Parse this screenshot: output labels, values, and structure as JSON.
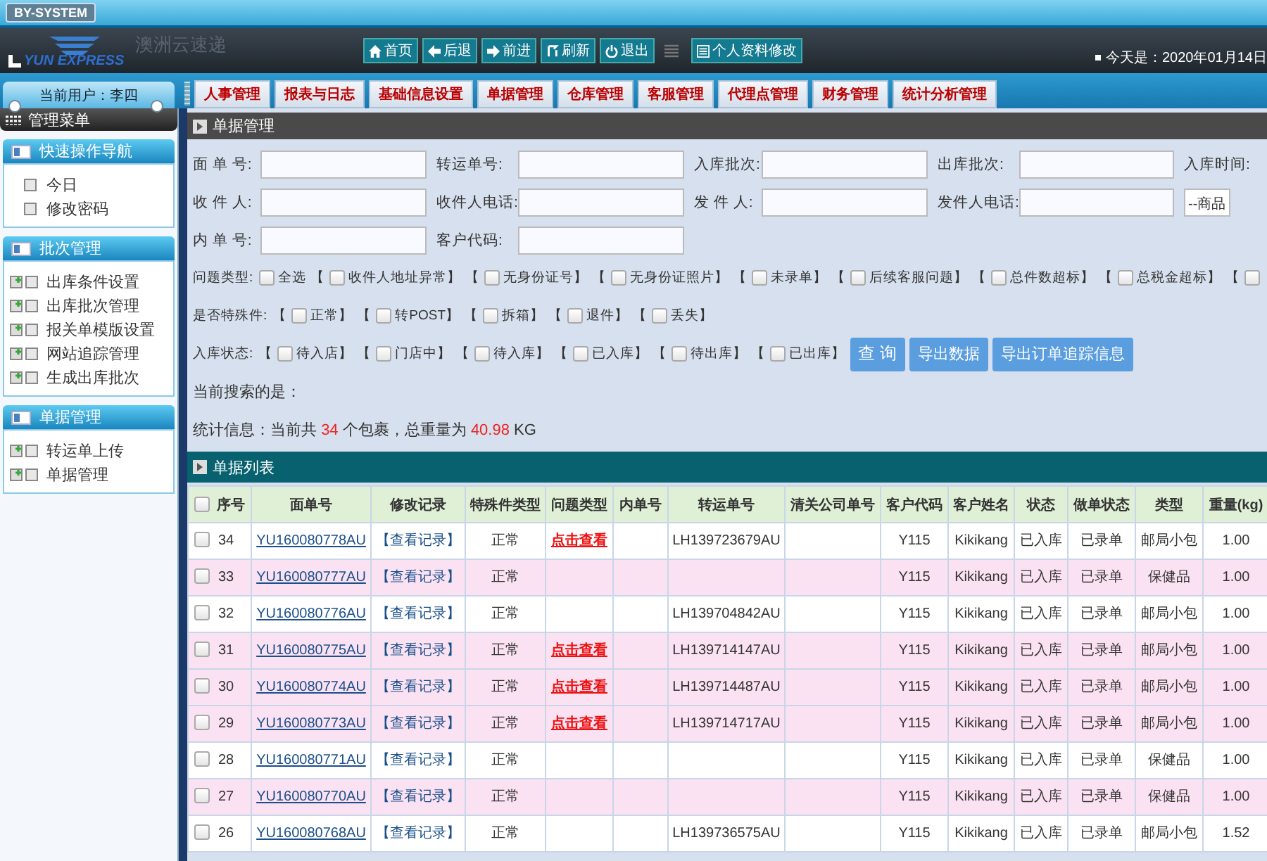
{
  "system_badge": "BY-SYSTEM",
  "logo": {
    "brand": "YUN EXPRESS",
    "name": "澳洲云速递"
  },
  "nav_buttons": [
    "首页",
    "后退",
    "前进",
    "刷新",
    "退出"
  ],
  "profile_button": "个人资料修改",
  "date": "今天是：2020年01月14日",
  "current_user": "当前用户：李四",
  "menu_tabs": [
    {
      "label": "人事管理",
      "selected": false
    },
    {
      "label": "报表与日志",
      "selected": false
    },
    {
      "label": "基础信息设置",
      "selected": false
    },
    {
      "label": "单据管理",
      "selected": false
    },
    {
      "label": "仓库管理",
      "selected": false
    },
    {
      "label": "客服管理",
      "selected": false
    },
    {
      "label": "代理点管理",
      "selected": false
    },
    {
      "label": "财务管理",
      "selected": false
    },
    {
      "label": "统计分析管理",
      "selected": false
    }
  ],
  "sidebar": {
    "title": "管理菜单",
    "sections": [
      {
        "title": "快速操作导航",
        "items": [
          {
            "label": "今日",
            "kind": "page"
          },
          {
            "label": "修改密码",
            "kind": "page"
          }
        ]
      },
      {
        "title": "批次管理",
        "items": [
          {
            "label": "出库条件设置",
            "kind": "add-page"
          },
          {
            "label": "出库批次管理",
            "kind": "add-page"
          },
          {
            "label": "报关单模版设置",
            "kind": "add-page"
          },
          {
            "label": "网站追踪管理",
            "kind": "add-page"
          },
          {
            "label": "生成出库批次",
            "kind": "add-page"
          }
        ]
      },
      {
        "title": "单据管理",
        "items": [
          {
            "label": "转运单上传",
            "kind": "add-page"
          },
          {
            "label": "单据管理",
            "kind": "add-page"
          }
        ]
      }
    ]
  },
  "search_panel": {
    "title": "单据管理",
    "form_rows": [
      [
        {
          "label": "面 单 号:",
          "kind": "input"
        },
        {
          "label": "转运单号:",
          "kind": "input"
        },
        {
          "label": "入库批次:",
          "kind": "input"
        },
        {
          "label": "出库批次:",
          "kind": "input"
        },
        {
          "label": "入库时间:",
          "kind": "label"
        }
      ],
      [
        {
          "label": "收 件 人:",
          "kind": "input"
        },
        {
          "label": "收件人电话:",
          "kind": "input"
        },
        {
          "label": "发 件 人:",
          "kind": "input"
        },
        {
          "label": "发件人电话:",
          "kind": "input"
        },
        {
          "value": "--商品",
          "kind": "select"
        }
      ],
      [
        {
          "label": "内 单 号:",
          "kind": "input"
        },
        {
          "label": "客户代码:",
          "kind": "input"
        }
      ]
    ],
    "filters": [
      {
        "label": "问题类型:",
        "options": [
          {
            "label": "全选",
            "checked": false
          },
          {
            "prefix": "【",
            "label": "收件人地址异常】",
            "checked": false
          },
          {
            "prefix": "【",
            "label": "无身份证号】",
            "checked": false
          },
          {
            "prefix": "【",
            "label": "无身份证照片】",
            "checked": false
          },
          {
            "prefix": "【",
            "label": "未录单】",
            "checked": false
          },
          {
            "prefix": "【",
            "label": "后续客服问题】",
            "checked": false
          },
          {
            "prefix": "【",
            "label": "总件数超标】",
            "checked": false
          },
          {
            "prefix": "【",
            "label": "总税金超标】",
            "checked": false
          },
          {
            "prefix": "【",
            "checked": false
          }
        ]
      },
      {
        "label": "是否特殊件:",
        "options": [
          {
            "prefix": "【",
            "label": "正常】",
            "checked": false
          },
          {
            "prefix": "【",
            "label": "转POST】",
            "checked": false
          },
          {
            "prefix": "【",
            "label": "拆箱】",
            "checked": false
          },
          {
            "prefix": "【",
            "label": "退件】",
            "checked": false
          },
          {
            "prefix": "【",
            "label": "丢失】",
            "checked": false
          }
        ]
      },
      {
        "label": "入库状态:",
        "options": [
          {
            "prefix": "【",
            "label": "待入店】",
            "checked": false
          },
          {
            "prefix": "【",
            "label": "门店中】",
            "checked": false
          },
          {
            "prefix": "【",
            "label": "待入库】",
            "checked": false
          },
          {
            "prefix": "【",
            "label": "已入库】",
            "checked": false
          },
          {
            "prefix": "【",
            "label": "待出库】",
            "checked": false
          },
          {
            "prefix": "【",
            "label": "已出库】",
            "checked": false
          }
        ],
        "buttons": [
          "查 询",
          "导出数据",
          "导出订单追踪信息"
        ]
      }
    ],
    "current_search": "当前搜索的是：",
    "stats": "统计信息：当前共 **34** 个包裹，总重量为 **40.98** KG"
  },
  "list": {
    "title": "单据列表",
    "header_checked": false,
    "columns": [
      "序号",
      "面单号",
      "修改记录",
      "特殊件类型",
      "问题类型",
      "内单号",
      "转运单号",
      "清关公司单号",
      "客户代码",
      "客户姓名",
      "状态",
      "做单状态",
      "类型",
      "重量(kg)"
    ],
    "rows": [
      {
        "no": "34",
        "waybill": "YU160080778AU",
        "record": "【查看记录】",
        "special": "正常",
        "problem": "点击查看",
        "transfer": "LH139723679AU",
        "code": "Y115",
        "name": "Kikikang",
        "status": "已入库",
        "make_status": "已录单",
        "type": "邮局小包",
        "weight": "1.00",
        "checked": false,
        "highlighted": false
      },
      {
        "no": "33",
        "waybill": "YU160080777AU",
        "record": "【查看记录】",
        "special": "正常",
        "code": "Y115",
        "name": "Kikikang",
        "status": "已入库",
        "make_status": "已录单",
        "type": "保健品",
        "weight": "1.00",
        "checked": false,
        "highlighted": true
      },
      {
        "no": "32",
        "waybill": "YU160080776AU",
        "record": "【查看记录】",
        "special": "正常",
        "transfer": "LH139704842AU",
        "code": "Y115",
        "name": "Kikikang",
        "status": "已入库",
        "make_status": "已录单",
        "type": "邮局小包",
        "weight": "1.00",
        "checked": false,
        "highlighted": false
      },
      {
        "no": "31",
        "waybill": "YU160080775AU",
        "record": "【查看记录】",
        "special": "正常",
        "problem": "点击查看",
        "transfer": "LH139714147AU",
        "code": "Y115",
        "name": "Kikikang",
        "status": "已入库",
        "make_status": "已录单",
        "type": "邮局小包",
        "weight": "1.00",
        "checked": false,
        "highlighted": true
      },
      {
        "no": "30",
        "waybill": "YU160080774AU",
        "record": "【查看记录】",
        "special": "正常",
        "problem": "点击查看",
        "transfer": "LH139714487AU",
        "code": "Y115",
        "name": "Kikikang",
        "status": "已入库",
        "make_status": "已录单",
        "type": "邮局小包",
        "weight": "1.00",
        "checked": false,
        "highlighted": true
      },
      {
        "no": "29",
        "waybill": "YU160080773AU",
        "record": "【查看记录】",
        "special": "正常",
        "problem": "点击查看",
        "transfer": "LH139714717AU",
        "code": "Y115",
        "name": "Kikikang",
        "status": "已入库",
        "make_status": "已录单",
        "type": "邮局小包",
        "weight": "1.00",
        "checked": false,
        "highlighted": true
      },
      {
        "no": "28",
        "waybill": "YU160080771AU",
        "record": "【查看记录】",
        "special": "正常",
        "code": "Y115",
        "name": "Kikikang",
        "status": "已入库",
        "make_status": "已录单",
        "type": "保健品",
        "weight": "1.00",
        "checked": false,
        "highlighted": false
      },
      {
        "no": "27",
        "waybill": "YU160080770AU",
        "record": "【查看记录】",
        "special": "正常",
        "code": "Y115",
        "name": "Kikikang",
        "status": "已入库",
        "make_status": "已录单",
        "type": "保健品",
        "weight": "1.00",
        "checked": false,
        "highlighted": true
      },
      {
        "no": "26",
        "waybill": "YU160080768AU",
        "record": "【查看记录】",
        "special": "正常",
        "transfer": "LH139736575AU",
        "code": "Y115",
        "name": "Kikikang",
        "status": "已入库",
        "make_status": "已录单",
        "type": "邮局小包",
        "weight": "1.52",
        "checked": false,
        "highlighted": false
      }
    ]
  }
}
